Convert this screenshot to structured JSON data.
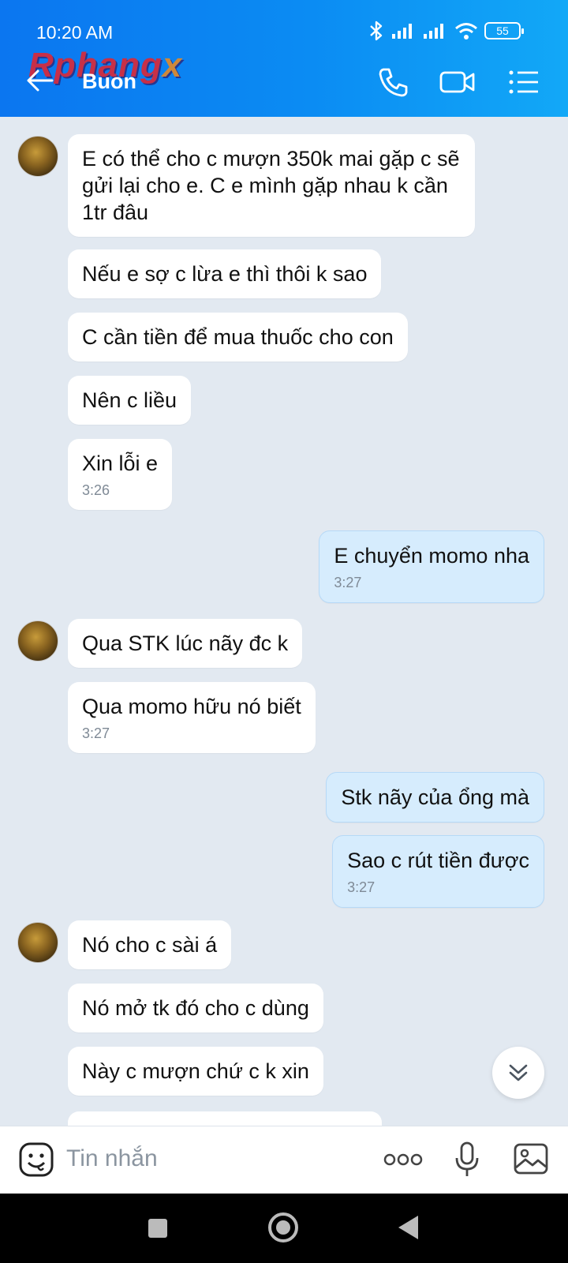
{
  "status_bar": {
    "time": "10:20 AM",
    "battery": "55"
  },
  "watermark": {
    "main": "Rphang",
    "x": "x"
  },
  "header": {
    "title": "Buon"
  },
  "messages": [
    {
      "from": "them",
      "text": "E có thể cho c mượn 350k mai gặp c sẽ gửi lại cho e. C e mình gặp nhau k cần 1tr đâu"
    },
    {
      "from": "them",
      "text": "Nếu e sợ c lừa e thì thôi k sao"
    },
    {
      "from": "them",
      "text": "C cần tiền để mua thuốc cho con"
    },
    {
      "from": "them",
      "text": "Nên c liều"
    },
    {
      "from": "them",
      "text": "Xin lỗi e",
      "time": "3:26"
    },
    {
      "from": "me",
      "text": "E chuyển momo nha",
      "time": "3:27"
    },
    {
      "from": "them",
      "text": "Qua STK lúc nãy đc k"
    },
    {
      "from": "them",
      "text": "Qua momo hữu nó biết",
      "time": "3:27"
    },
    {
      "from": "me",
      "text": "Stk nãy của ổng mà"
    },
    {
      "from": "me",
      "text": "Sao c rút tiền được",
      "time": "3:27"
    },
    {
      "from": "them",
      "text": "Nó cho c sài á"
    },
    {
      "from": "them",
      "text": "Nó mở tk đó cho c dùng"
    },
    {
      "from": "them",
      "text": "Này c mượn chứ c k xin"
    }
  ],
  "composer": {
    "placeholder": "Tin nhắn"
  },
  "colors": {
    "header_start": "#0b76f0",
    "header_end": "#12a8f7",
    "my_bubble": "#d6ecfd",
    "background": "#e2e9f1"
  }
}
